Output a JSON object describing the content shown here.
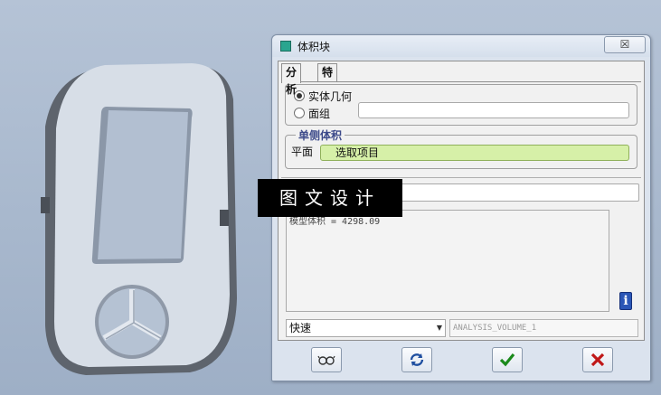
{
  "dialog": {
    "title": "体积块",
    "close_label": "☒"
  },
  "tabs": [
    {
      "label": "分析",
      "active": true
    },
    {
      "label": "特征",
      "active": false
    }
  ],
  "geometry": {
    "options": [
      {
        "label": "实体几何",
        "selected": true
      },
      {
        "label": "面组",
        "selected": false
      }
    ],
    "quilt_value": ""
  },
  "one_sided_volume": {
    "legend": "单侧体积",
    "plane_label": "平面",
    "collector_text": "选取项目"
  },
  "result": {
    "text": "模型体积 = 4298.09"
  },
  "bottom": {
    "mode": "快速",
    "analysis_name": "ANALYSIS_VOLUME_1"
  },
  "watermark": "图文设计",
  "icons": {
    "title": "dialog-icon",
    "info": "info-icon",
    "preview": "glasses-icon",
    "repeat": "repeat-icon",
    "ok": "checkmark-icon",
    "cancel": "cross-icon"
  },
  "colors": {
    "collector": "#d6f0a8",
    "ok": "#1b8a1b",
    "cancel": "#c01818",
    "info": "#2b56b6"
  }
}
